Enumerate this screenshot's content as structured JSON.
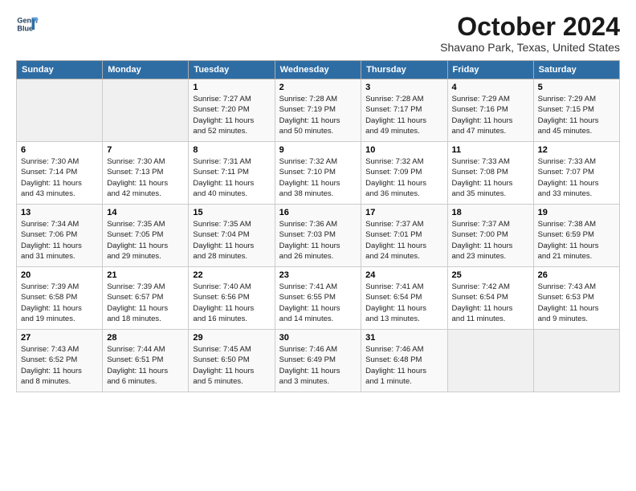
{
  "header": {
    "logo_line1": "General",
    "logo_line2": "Blue",
    "month_title": "October 2024",
    "location": "Shavano Park, Texas, United States"
  },
  "days_of_week": [
    "Sunday",
    "Monday",
    "Tuesday",
    "Wednesday",
    "Thursday",
    "Friday",
    "Saturday"
  ],
  "weeks": [
    [
      {
        "num": "",
        "info": ""
      },
      {
        "num": "",
        "info": ""
      },
      {
        "num": "1",
        "info": "Sunrise: 7:27 AM\nSunset: 7:20 PM\nDaylight: 11 hours\nand 52 minutes."
      },
      {
        "num": "2",
        "info": "Sunrise: 7:28 AM\nSunset: 7:19 PM\nDaylight: 11 hours\nand 50 minutes."
      },
      {
        "num": "3",
        "info": "Sunrise: 7:28 AM\nSunset: 7:17 PM\nDaylight: 11 hours\nand 49 minutes."
      },
      {
        "num": "4",
        "info": "Sunrise: 7:29 AM\nSunset: 7:16 PM\nDaylight: 11 hours\nand 47 minutes."
      },
      {
        "num": "5",
        "info": "Sunrise: 7:29 AM\nSunset: 7:15 PM\nDaylight: 11 hours\nand 45 minutes."
      }
    ],
    [
      {
        "num": "6",
        "info": "Sunrise: 7:30 AM\nSunset: 7:14 PM\nDaylight: 11 hours\nand 43 minutes."
      },
      {
        "num": "7",
        "info": "Sunrise: 7:30 AM\nSunset: 7:13 PM\nDaylight: 11 hours\nand 42 minutes."
      },
      {
        "num": "8",
        "info": "Sunrise: 7:31 AM\nSunset: 7:11 PM\nDaylight: 11 hours\nand 40 minutes."
      },
      {
        "num": "9",
        "info": "Sunrise: 7:32 AM\nSunset: 7:10 PM\nDaylight: 11 hours\nand 38 minutes."
      },
      {
        "num": "10",
        "info": "Sunrise: 7:32 AM\nSunset: 7:09 PM\nDaylight: 11 hours\nand 36 minutes."
      },
      {
        "num": "11",
        "info": "Sunrise: 7:33 AM\nSunset: 7:08 PM\nDaylight: 11 hours\nand 35 minutes."
      },
      {
        "num": "12",
        "info": "Sunrise: 7:33 AM\nSunset: 7:07 PM\nDaylight: 11 hours\nand 33 minutes."
      }
    ],
    [
      {
        "num": "13",
        "info": "Sunrise: 7:34 AM\nSunset: 7:06 PM\nDaylight: 11 hours\nand 31 minutes."
      },
      {
        "num": "14",
        "info": "Sunrise: 7:35 AM\nSunset: 7:05 PM\nDaylight: 11 hours\nand 29 minutes."
      },
      {
        "num": "15",
        "info": "Sunrise: 7:35 AM\nSunset: 7:04 PM\nDaylight: 11 hours\nand 28 minutes."
      },
      {
        "num": "16",
        "info": "Sunrise: 7:36 AM\nSunset: 7:03 PM\nDaylight: 11 hours\nand 26 minutes."
      },
      {
        "num": "17",
        "info": "Sunrise: 7:37 AM\nSunset: 7:01 PM\nDaylight: 11 hours\nand 24 minutes."
      },
      {
        "num": "18",
        "info": "Sunrise: 7:37 AM\nSunset: 7:00 PM\nDaylight: 11 hours\nand 23 minutes."
      },
      {
        "num": "19",
        "info": "Sunrise: 7:38 AM\nSunset: 6:59 PM\nDaylight: 11 hours\nand 21 minutes."
      }
    ],
    [
      {
        "num": "20",
        "info": "Sunrise: 7:39 AM\nSunset: 6:58 PM\nDaylight: 11 hours\nand 19 minutes."
      },
      {
        "num": "21",
        "info": "Sunrise: 7:39 AM\nSunset: 6:57 PM\nDaylight: 11 hours\nand 18 minutes."
      },
      {
        "num": "22",
        "info": "Sunrise: 7:40 AM\nSunset: 6:56 PM\nDaylight: 11 hours\nand 16 minutes."
      },
      {
        "num": "23",
        "info": "Sunrise: 7:41 AM\nSunset: 6:55 PM\nDaylight: 11 hours\nand 14 minutes."
      },
      {
        "num": "24",
        "info": "Sunrise: 7:41 AM\nSunset: 6:54 PM\nDaylight: 11 hours\nand 13 minutes."
      },
      {
        "num": "25",
        "info": "Sunrise: 7:42 AM\nSunset: 6:54 PM\nDaylight: 11 hours\nand 11 minutes."
      },
      {
        "num": "26",
        "info": "Sunrise: 7:43 AM\nSunset: 6:53 PM\nDaylight: 11 hours\nand 9 minutes."
      }
    ],
    [
      {
        "num": "27",
        "info": "Sunrise: 7:43 AM\nSunset: 6:52 PM\nDaylight: 11 hours\nand 8 minutes."
      },
      {
        "num": "28",
        "info": "Sunrise: 7:44 AM\nSunset: 6:51 PM\nDaylight: 11 hours\nand 6 minutes."
      },
      {
        "num": "29",
        "info": "Sunrise: 7:45 AM\nSunset: 6:50 PM\nDaylight: 11 hours\nand 5 minutes."
      },
      {
        "num": "30",
        "info": "Sunrise: 7:46 AM\nSunset: 6:49 PM\nDaylight: 11 hours\nand 3 minutes."
      },
      {
        "num": "31",
        "info": "Sunrise: 7:46 AM\nSunset: 6:48 PM\nDaylight: 11 hours\nand 1 minute."
      },
      {
        "num": "",
        "info": ""
      },
      {
        "num": "",
        "info": ""
      }
    ]
  ]
}
